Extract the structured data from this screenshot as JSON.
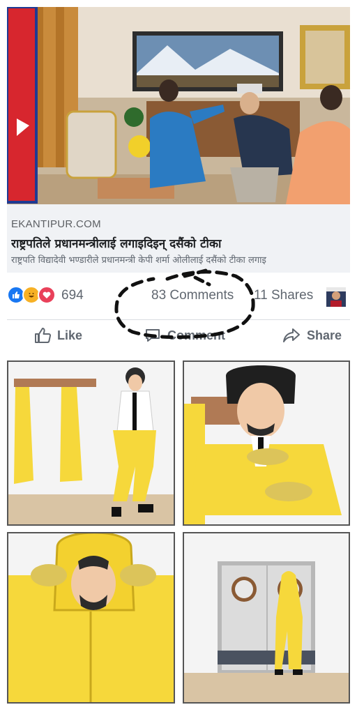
{
  "link": {
    "domain": "EKANTIPUR.COM",
    "headline": "राष्ट्रपतिले प्रधानमन्त्रीलाई लगाइदिइन् दसैंको टीका",
    "description": "राष्ट्रपति विद्यादेवी भण्डारीले प्रधानमन्त्री केपी शर्मा ओलीलाई दसैंको टीका लगाइ"
  },
  "stats": {
    "reactions_count": "694",
    "comments": "83 Comments",
    "shares": "11 Shares",
    "reaction_icons": [
      "like-icon",
      "haha-icon",
      "love-icon"
    ]
  },
  "actions": {
    "like": "Like",
    "comment": "Comment",
    "share": "Share"
  },
  "colors": {
    "like_blue": "#1877f2",
    "haha_yellow": "#f7b125",
    "love_red": "#e9415a",
    "suit_yellow": "#f6d83b"
  }
}
